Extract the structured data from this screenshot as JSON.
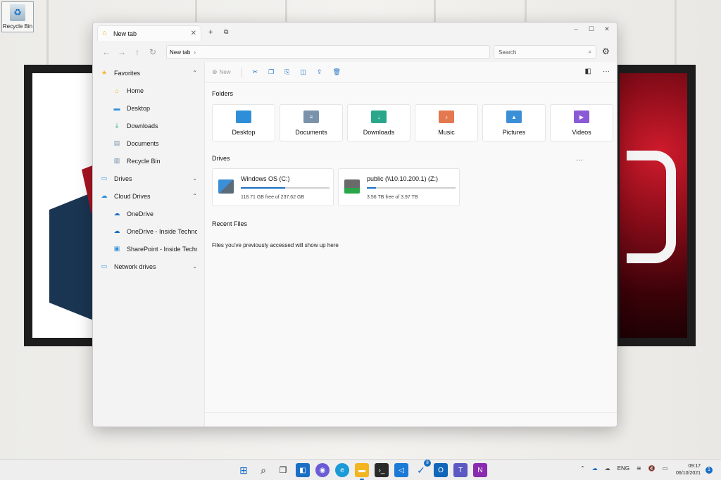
{
  "desktop": {
    "recycle_bin_label": "Recycle Bin"
  },
  "window": {
    "tab_title": "New tab",
    "new_tab_glyph": "+",
    "tab_close_glyph": "✕",
    "controls": {
      "minimize": "–",
      "maximize": "☐",
      "close": "✕"
    }
  },
  "navbar": {
    "back": "←",
    "forward": "→",
    "up": "↑",
    "refresh": "↻",
    "address_path": "New tab",
    "search_placeholder": "Search"
  },
  "sidebar": {
    "items": [
      {
        "label": "Favorites",
        "icon": "star-icon",
        "level": 1,
        "chevron": "expanded"
      },
      {
        "label": "Home",
        "icon": "home-icon",
        "level": 2
      },
      {
        "label": "Desktop",
        "icon": "desktop-icon",
        "level": 2
      },
      {
        "label": "Downloads",
        "icon": "downloads-icon",
        "level": 2
      },
      {
        "label": "Documents",
        "icon": "documents-icon",
        "level": 2
      },
      {
        "label": "Recycle Bin",
        "icon": "recycle-bin-icon",
        "level": 2
      },
      {
        "label": "Drives",
        "icon": "drive-icon",
        "level": 1,
        "chevron": "collapsed"
      },
      {
        "label": "Cloud Drives",
        "icon": "cloud-drive-icon",
        "level": 1,
        "chevron": "expanded"
      },
      {
        "label": "OneDrive",
        "icon": "onedrive-icon",
        "level": 2
      },
      {
        "label": "OneDrive - Inside Techno",
        "icon": "onedrive-icon",
        "level": 2
      },
      {
        "label": "SharePoint - Inside Techn",
        "icon": "sharepoint-icon",
        "level": 2
      },
      {
        "label": "Network drives",
        "icon": "network-drive-icon",
        "level": 1,
        "chevron": "collapsed"
      }
    ]
  },
  "cmdbar": {
    "new_label": "New"
  },
  "folders": {
    "title": "Folders",
    "items": [
      {
        "label": "Desktop",
        "color": "#2e8fd8"
      },
      {
        "label": "Documents",
        "color": "#7a93ab"
      },
      {
        "label": "Downloads",
        "color": "#2aa68a"
      },
      {
        "label": "Music",
        "color": "#e4784e"
      },
      {
        "label": "Pictures",
        "color": "#3a8fd6"
      },
      {
        "label": "Videos",
        "color": "#8a5ad6"
      }
    ]
  },
  "drives": {
    "title": "Drives",
    "more_glyph": "···",
    "items": [
      {
        "name": "Windows OS (C:)",
        "free_text": "118.71 GB free of 237.62 GB",
        "used_fraction": 0.5
      },
      {
        "name": "public (\\\\10.10.200.1) (Z:)",
        "free_text": "3.56 TB free of 3.97 TB",
        "used_fraction": 0.1
      }
    ]
  },
  "recent": {
    "title": "Recent Files",
    "empty_message": "Files you've previously accessed will show up here"
  },
  "taskbar": {
    "tray_lang": "ENG",
    "time": "09:17",
    "date": "06/10/2021",
    "notification_count": "1",
    "steam_badge": "8"
  },
  "colors": {
    "accent": "#1a6fc4"
  }
}
